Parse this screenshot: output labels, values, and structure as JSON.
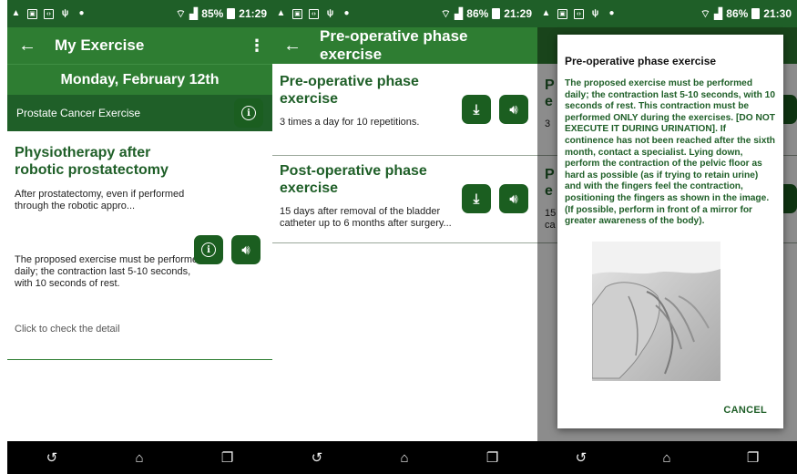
{
  "status": [
    {
      "battery": "85%",
      "time": "21:29"
    },
    {
      "battery": "86%",
      "time": "21:29"
    },
    {
      "battery": "86%",
      "time": "21:30"
    }
  ],
  "screen1": {
    "title": "My Exercise",
    "date": "Monday, February 12th",
    "category": "Prostate Cancer Exercise",
    "card_title": "Physiotherapy after robotic prostatectomy",
    "card_intro": "After prostatectomy, even if performed through the robotic appro...",
    "card_desc": "The proposed exercise must be performed daily; the contraction last 5-10 seconds, with 10 seconds of rest.",
    "detail_link": "Click to check the detail"
  },
  "screen2": {
    "title": "Pre-operative phase exercise",
    "exercises": [
      {
        "title": "Pre-operative phase exercise",
        "desc": "3 times a day for 10 repetitions."
      },
      {
        "title": "Post-operative phase exercise",
        "desc": "15 days after removal of the bladder catheter up to 6 months after surgery..."
      }
    ]
  },
  "screen3": {
    "behind": [
      "P",
      "e",
      "3",
      "P",
      "e",
      "15",
      "ca"
    ],
    "dialog": {
      "title": "Pre-operative phase exercise",
      "body": "The proposed exercise must be performed daily; the contraction last 5-10 seconds, with 10 seconds of rest. This contraction must be performed ONLY during the exercises. [DO NOT EXECUTE IT DURING URINATION]. If continence has not been reached after the sixth month, contact a specialist. Lying down, perform the contraction of the pelvic floor as hard as possible (as if trying to retain urine) and with the fingers feel the contraction, positioning the fingers as shown in the image. (If possible, perform in front of a mirror for greater awareness of the body).",
      "cancel": "CANCEL"
    }
  },
  "colors": {
    "primary": "#2e7d32",
    "dark": "#1f5f28"
  }
}
